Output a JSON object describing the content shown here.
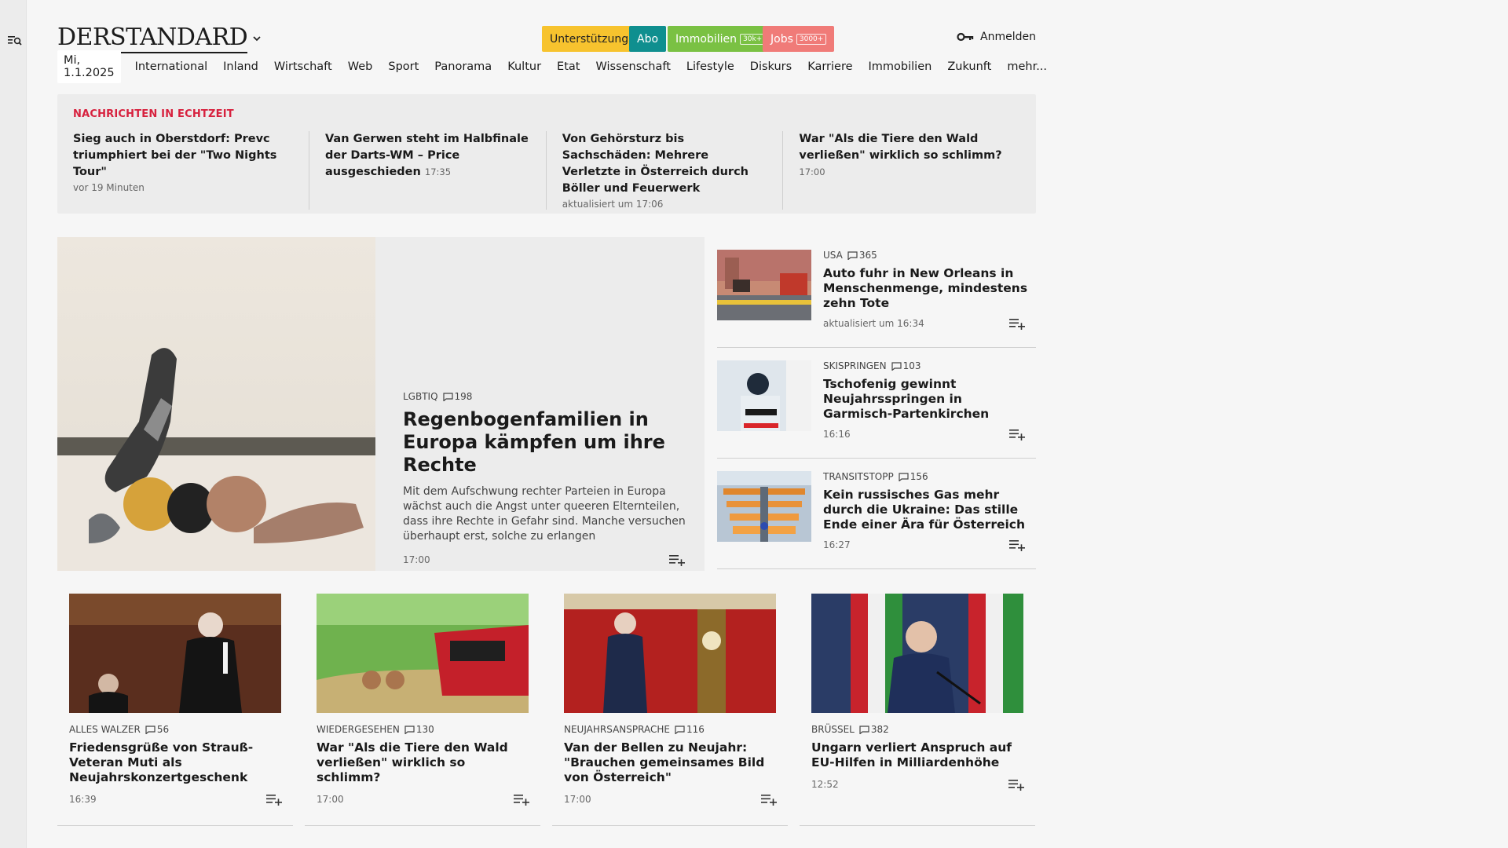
{
  "logo": "DERSTANDARD",
  "promos": {
    "support": "Unterstützung",
    "abo": "Abo",
    "immo": "Immobilien",
    "immo_tag": "30k+",
    "jobs": "Jobs",
    "jobs_tag": "3000+"
  },
  "login": "Anmelden",
  "nav": {
    "date": "Mi, 1.1.2025",
    "items": [
      "International",
      "Inland",
      "Wirtschaft",
      "Web",
      "Sport",
      "Panorama",
      "Kultur",
      "Etat",
      "Wissenschaft",
      "Lifestyle",
      "Diskurs",
      "Karriere",
      "Immobilien",
      "Zukunft",
      "mehr..."
    ]
  },
  "ticker": {
    "title": "NACHRICHTEN IN ECHTZEIT",
    "items": [
      {
        "head": "Sieg auch in Oberstdorf: Prevc triumphiert bei der \"Two Nights Tour\"",
        "time": "",
        "sub": "vor 19 Minuten"
      },
      {
        "head": "Van Gerwen steht im Halbfinale der Darts-WM – Price ausgeschieden",
        "time": "17:35",
        "sub": ""
      },
      {
        "head": "Von Gehörsturz bis Sachschäden: Mehrere Verletzte in Österreich durch Böller und Feuerwerk",
        "time": "",
        "sub": "aktualisiert um 17:06"
      },
      {
        "head": "War \"Als die Tiere den Wald verließen\" wirklich so schlimm?",
        "time": "17:00",
        "sub": ""
      }
    ]
  },
  "hero": {
    "kicker": "LGBTIQ",
    "comments": "198",
    "title": "Regenbogenfamilien in Europa kämpfen um ihre Rechte",
    "lead": "Mit dem Aufschwung rechter Parteien in Europa wächst auch die Angst unter queeren Elternteilen, dass ihre Rechte in Gefahr sind. Manche versuchen überhaupt erst, solche zu erlangen",
    "time": "17:00"
  },
  "side": [
    {
      "kicker": "USA",
      "comments": "365",
      "title": "Auto fuhr in New Orleans in Menschenmenge, mindestens zehn Tote",
      "time": "aktualisiert um 16:34"
    },
    {
      "kicker": "SKISPRINGEN",
      "comments": "103",
      "title": "Tschofenig gewinnt Neujahrsspringen in Garmisch-Partenkirchen",
      "time": "16:16"
    },
    {
      "kicker": "TRANSITSTOPP",
      "comments": "156",
      "title": "Kein russisches Gas mehr durch die Ukraine: Das stille Ende einer Ära für Österreich",
      "time": "16:27"
    }
  ],
  "cards": [
    {
      "kicker": "ALLES WALZER",
      "comments": "56",
      "title": "Friedensgrüße von Strauß-Veteran Muti als Neujahrskonzertgeschenk",
      "time": "16:39"
    },
    {
      "kicker": "WIEDERGESEHEN",
      "comments": "130",
      "title": "War \"Als die Tiere den Wald verließen\" wirklich so schlimm?",
      "time": "17:00"
    },
    {
      "kicker": "NEUJAHRSANSPRACHE",
      "comments": "116",
      "title": "Van der Bellen zu Neujahr: \"Brauchen gemeinsames Bild von Österreich\"",
      "time": "17:00"
    },
    {
      "kicker": "BRÜSSEL",
      "comments": "382",
      "title": "Ungarn verliert Anspruch auf EU-Hilfen in Milliardenhöhe",
      "time": "12:52"
    }
  ],
  "colors": {
    "ticker_red": "#d7213e",
    "support": "#f7c32e",
    "abo": "#0f8f8f",
    "immo": "#7ac143",
    "jobs": "#f07b78"
  },
  "icons": [
    "menu-search-icon",
    "chevron-down-icon",
    "key-icon",
    "comment-icon",
    "add-to-list-icon"
  ]
}
